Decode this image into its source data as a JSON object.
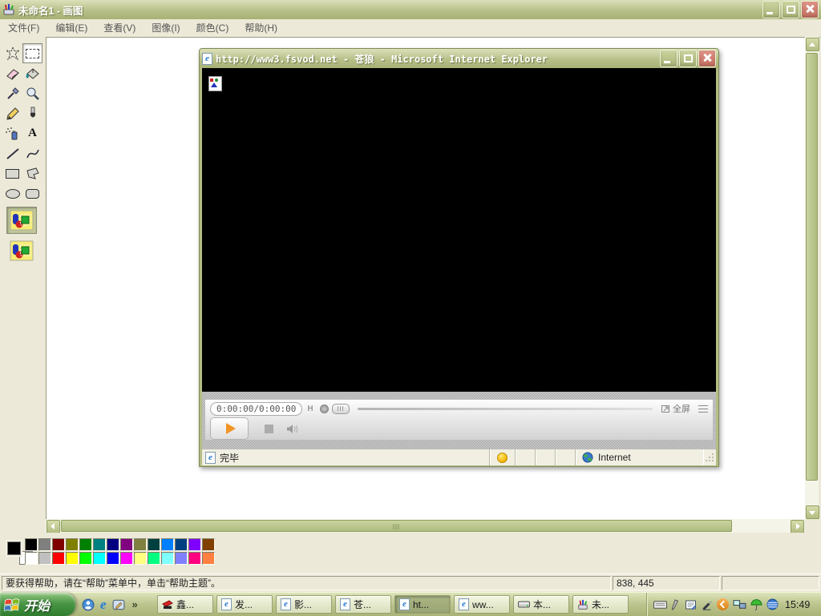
{
  "colors": {
    "titlebar_top": "#dce0ba",
    "titlebar_bottom": "#a7b174",
    "close_button": "#c26d5e",
    "panel_bg": "#ece9d8",
    "play_accent": "#f29423",
    "taskbar_active": "#9aa673"
  },
  "paint": {
    "window_title": "未命名1 - 画图",
    "menu_items": [
      "文件(F)",
      "编辑(E)",
      "查看(V)",
      "图像(I)",
      "颜色(C)",
      "帮助(H)"
    ],
    "tools": [
      "free-form-select",
      "select",
      "eraser",
      "fill-with-color",
      "pick-color",
      "magnifier",
      "pencil",
      "brush",
      "airbrush",
      "text",
      "line",
      "curve",
      "rectangle",
      "polygon",
      "ellipse",
      "rounded-rectangle"
    ],
    "selected_tool": "select",
    "text_tool_glyph": "A",
    "palette_row1": [
      "#000000",
      "#808080",
      "#800000",
      "#808000",
      "#008000",
      "#008080",
      "#000080",
      "#800080",
      "#808040",
      "#004040",
      "#0080ff",
      "#004080",
      "#8000ff",
      "#804000"
    ],
    "palette_row2": [
      "#ffffff",
      "#c0c0c0",
      "#ff0000",
      "#ffff00",
      "#00ff00",
      "#00ffff",
      "#0000ff",
      "#ff00ff",
      "#ffff80",
      "#00ff80",
      "#80ffff",
      "#8080ff",
      "#ff0080",
      "#ff8040"
    ],
    "status_help_text": "要获得帮助，请在“帮助”菜单中，单击“帮助主题”。",
    "cursor_coords": "838, 445"
  },
  "ie": {
    "window_title": "http://www3.fsvod.net - 苍狼 - Microsoft Internet Explorer",
    "status_done": "完毕",
    "status_zone_label": "Internet",
    "player": {
      "time_display": "0:00:00/0:00:00",
      "hd_label": "H",
      "fullscreen_label": "全屏"
    }
  },
  "taskbar": {
    "start_label": "开始",
    "overflow_chevron": "»",
    "buttons": [
      {
        "label": "鑫...",
        "icon": "app-red-flag",
        "active": false
      },
      {
        "label": "发...",
        "icon": "ie-page",
        "active": false
      },
      {
        "label": "影...",
        "icon": "ie-page",
        "active": false
      },
      {
        "label": "苍...",
        "icon": "ie-page",
        "active": false
      },
      {
        "label": "ht...",
        "icon": "ie-page",
        "active": true
      },
      {
        "label": "ww...",
        "icon": "ie-page",
        "active": false
      },
      {
        "label": "本...",
        "icon": "drive",
        "active": false
      },
      {
        "label": "未...",
        "icon": "paint",
        "active": false
      }
    ],
    "clock": "15:49"
  },
  "icons": {
    "ie_glyph": "e"
  }
}
